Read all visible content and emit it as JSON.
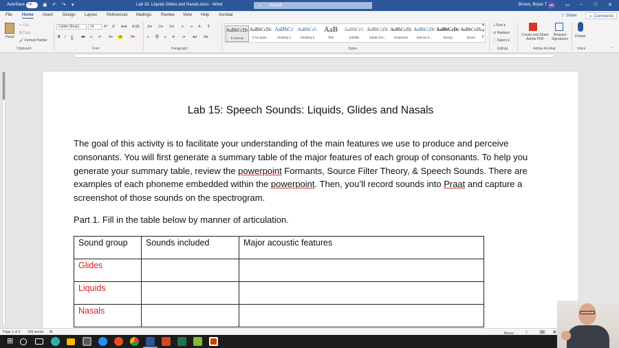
{
  "titlebar": {
    "autosave_label": "AutoSave",
    "autosave_state": "Off",
    "document_title": "Lab 15- Liquids Glides and Nasals.docx - Word",
    "search_placeholder": "Search",
    "user_name": "Brown, Bryan T",
    "user_initials": "BB"
  },
  "tabs": {
    "items": [
      "File",
      "Home",
      "Insert",
      "Design",
      "Layout",
      "References",
      "Mailings",
      "Review",
      "View",
      "Help",
      "Acrobat"
    ],
    "active": "Home",
    "share_label": "Share",
    "comments_label": "Comments"
  },
  "ribbon": {
    "clipboard": {
      "paste": "Paste",
      "cut": "Cut",
      "copy": "Copy",
      "format_painter": "Format Painter",
      "label": "Clipboard"
    },
    "font": {
      "name": "Calibri (Body)",
      "size": "14",
      "label": "Font"
    },
    "paragraph_label": "Paragraph",
    "styles": [
      {
        "sample": "AaBbCcDc",
        "name": "¶ Normal"
      },
      {
        "sample": "AaBbCcDc",
        "name": "¶ No Spac..."
      },
      {
        "sample": "AaBbCc",
        "name": "Heading 1"
      },
      {
        "sample": "AaBbCcC",
        "name": "Heading 2"
      },
      {
        "sample": "AaB",
        "name": "Title"
      },
      {
        "sample": "AaBbCcC",
        "name": "Subtitle"
      },
      {
        "sample": "AaBbCcDc",
        "name": "Subtle Em..."
      },
      {
        "sample": "AaBbCcDc",
        "name": "Emphasis"
      },
      {
        "sample": "AaBbCcDc",
        "name": "Intense E..."
      },
      {
        "sample": "AaBbCcDc",
        "name": "Strong"
      },
      {
        "sample": "AaBbCcDc",
        "name": "Quote"
      }
    ],
    "styles_label": "Styles",
    "editing": {
      "find": "Find",
      "replace": "Replace",
      "select": "Select",
      "label": "Editing"
    },
    "adobe": {
      "create_share": "Create and Share Adobe PDF",
      "request_signatures": "Request Signatures",
      "label": "Adobe Acrobat"
    },
    "voice": {
      "dictate": "Dictate",
      "label": "Voice"
    }
  },
  "document": {
    "title": "Lab 15: Speech Sounds: Liquids, Glides and Nasals",
    "intro_segments": [
      {
        "text": "The goal of this activity is to facilitate your understanding of the main features we use to produce and perceive consonants. You will first generate a summary table of the major features of each group of consonants. To help you generate your summary table, review the ",
        "style": ""
      },
      {
        "text": "powerpoint",
        "style": "squig"
      },
      {
        "text": " Formants, Source Filter Theory, & Speech Sounds. There are examples of each phoneme embedded within the ",
        "style": ""
      },
      {
        "text": "powerpoint",
        "style": "squig"
      },
      {
        "text": ". Then, you’ll record sounds into ",
        "style": ""
      },
      {
        "text": "Praat",
        "style": "squig"
      },
      {
        "text": " and capture a screenshot of those sounds on the spectrogram.",
        "style": ""
      }
    ],
    "part1": "Part 1. Fill in the table below by manner of articulation.",
    "table": {
      "headers": [
        "Sound group",
        "Sounds included",
        "Major acoustic features"
      ],
      "rows": [
        [
          "Glides",
          "",
          ""
        ],
        [
          "Liquids",
          "",
          ""
        ],
        [
          "Nasals",
          "",
          ""
        ]
      ]
    }
  },
  "statusbar": {
    "page": "Page 1 of 3",
    "words": "209 words",
    "focus": "Focus"
  },
  "colors": {
    "word_blue": "#2b579a",
    "red_label": "#d62020"
  }
}
